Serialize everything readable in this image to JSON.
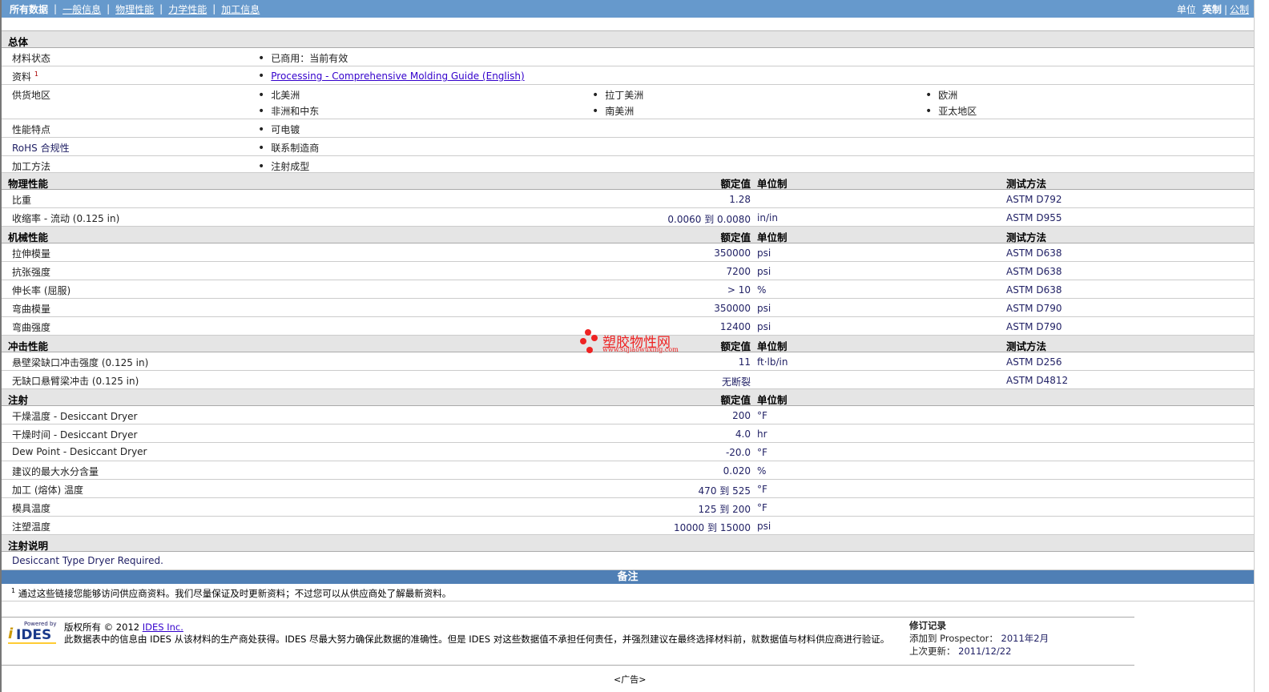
{
  "nav": {
    "items": [
      "所有数据",
      "一般信息",
      "物理性能",
      "力学性能",
      "加工信息"
    ],
    "units_label": "单位",
    "unit_en": "英制",
    "unit_metric": "公制"
  },
  "headers": {
    "value": "额定值",
    "unit": "单位制",
    "method": "测试方法"
  },
  "general": {
    "title": "总体",
    "status_label": "材料状态",
    "status_value": "已商用：当前有效",
    "docs_label": "资料",
    "docs_sup": "1",
    "docs_link": "Processing - Comprehensive Molding Guide (English)",
    "regions_label": "供货地区",
    "regions": [
      "北美洲",
      "拉丁美洲",
      "欧洲",
      "非洲和中东",
      "南美洲",
      "亚太地区"
    ],
    "features_label": "性能特点",
    "features_value": "可电镀",
    "rohs_label": "RoHS 合规性",
    "rohs_value": "联系制造商",
    "process_label": "加工方法",
    "process_value": "注射成型"
  },
  "sections": [
    {
      "title": "物理性能",
      "method": true,
      "rows": [
        {
          "label": "比重",
          "value": "1.28",
          "unit": "",
          "method": "ASTM D792"
        },
        {
          "label": "收缩率 - 流动 (0.125 in)",
          "value": "0.0060 到  0.0080",
          "unit": "in/in",
          "method": "ASTM D955"
        }
      ]
    },
    {
      "title": "机械性能",
      "method": true,
      "rows": [
        {
          "label": "拉伸模量",
          "value": "350000",
          "unit": "psi",
          "method": "ASTM D638"
        },
        {
          "label": "抗张强度",
          "value": "7200",
          "unit": "psi",
          "method": "ASTM D638"
        },
        {
          "label": "伸长率 (屈服)",
          "value": "> 10",
          "unit": "%",
          "method": "ASTM D638"
        },
        {
          "label": "弯曲模量",
          "value": "350000",
          "unit": "psi",
          "method": "ASTM D790"
        },
        {
          "label": "弯曲强度",
          "value": "12400",
          "unit": "psi",
          "method": "ASTM D790"
        }
      ]
    },
    {
      "title": "冲击性能",
      "method": true,
      "rows": [
        {
          "label": "悬壁梁缺口冲击强度 (0.125 in)",
          "value": "11",
          "unit": "ft·lb/in",
          "method": "ASTM D256"
        },
        {
          "label": "无缺口悬臂梁冲击 (0.125 in)",
          "value": "无断裂",
          "unit": "",
          "method": "ASTM D4812"
        }
      ]
    },
    {
      "title": "注射",
      "method": false,
      "rows": [
        {
          "label": "干燥温度 - Desiccant Dryer",
          "value": "200",
          "unit": "°F",
          "method": ""
        },
        {
          "label": "干燥时间 - Desiccant Dryer",
          "value": "4.0",
          "unit": "hr",
          "method": ""
        },
        {
          "label": "Dew Point - Desiccant Dryer",
          "value": "-20.0",
          "unit": "°F",
          "method": ""
        },
        {
          "label": "建议的最大水分含量",
          "value": "0.020",
          "unit": "%",
          "method": ""
        },
        {
          "label": "加工 (熔体) 温度",
          "value": "470 到  525",
          "unit": "°F",
          "method": ""
        },
        {
          "label": "模具温度",
          "value": "125 到  200",
          "unit": "°F",
          "method": ""
        },
        {
          "label": "注塑温度",
          "value": "10000 到  15000",
          "unit": "psi",
          "method": ""
        }
      ]
    }
  ],
  "notes": {
    "title": "注射说明",
    "text": "Desiccant Type Dryer Required."
  },
  "remarks": {
    "title": "备注",
    "sup": "1",
    "text": "通过这些链接您能够访问供应商资料。我们尽量保证及时更新资料；不过您可以从供应商处了解最新资料。"
  },
  "footer": {
    "powered": "Powered by",
    "brand": "IDES",
    "copyright": "版权所有 © 2012",
    "company_link": "IDES Inc.",
    "disclaimer": "此数据表中的信息由 IDES 从该材料的生产商处获得。IDES 尽最大努力确保此数据的准确性。但是 IDES 对这些数据值不承担任何责任，并强烈建议在最终选择材料前，就数据值与材料供应商进行验证。",
    "rev_title": "修订记录",
    "added_label": "添加到 Prospector：",
    "added_value": "2011年2月",
    "updated_label": "上次更新：",
    "updated_value": "2011/12/22"
  },
  "ad": "<广告>",
  "watermark": {
    "name": "塑胶物性网",
    "url": "www.sujiaowuxing.com"
  }
}
